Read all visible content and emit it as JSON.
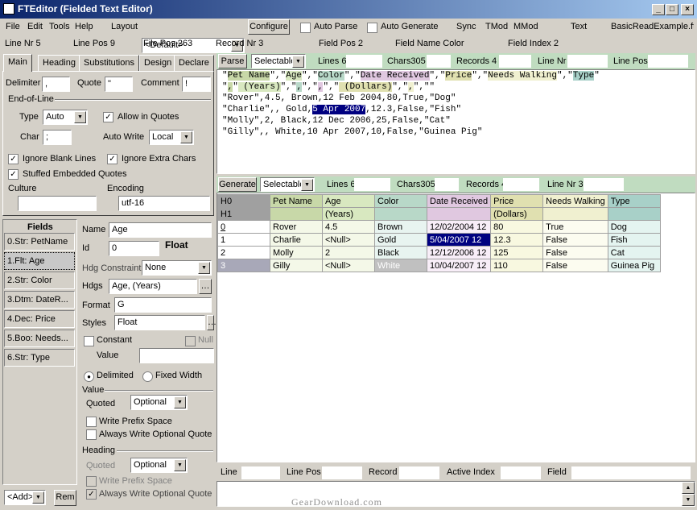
{
  "window": {
    "title": "FTEditor (Fielded Text Editor)",
    "min": "_",
    "max": "□",
    "close": "×"
  },
  "menu": {
    "file": "File",
    "edit": "Edit",
    "tools": "Tools",
    "help": "Help"
  },
  "toolbar": {
    "layout_label": "Layout",
    "layout_value": "<Default>",
    "configure": "Configure",
    "auto_parse": "Auto Parse",
    "auto_generate": "Auto Generate",
    "sync": "Sync",
    "tmod": "TMod",
    "mmod": "MMod",
    "text": "Text",
    "filename": "BasicReadExample.ftx"
  },
  "info": {
    "line_nr": "Line Nr 5",
    "line_pos": "Line Pos 9",
    "file_pos": "File Pos 263",
    "record_nr": "Record Nr 3",
    "field_pos": "Field Pos 2",
    "field_name": "Field Name Color",
    "field_index": "Field Index 2"
  },
  "tabs": [
    "Main",
    "Heading",
    "Substitutions",
    "Design",
    "Declare"
  ],
  "main": {
    "delimiter_label": "Delimiter",
    "delimiter": ",",
    "quote_label": "Quote",
    "quote": "\"",
    "comment_label": "Comment",
    "comment": "!",
    "eol_label": "End-of-Line",
    "type_label": "Type",
    "type": "Auto",
    "char_label": "Char",
    "char": ";",
    "allow_quotes": "Allow in Quotes",
    "auto_write_label": "Auto Write",
    "auto_write": "Local",
    "ignore_blank": "Ignore Blank Lines",
    "ignore_extra": "Ignore Extra Chars",
    "stuffed": "Stuffed Embedded Quotes",
    "culture_label": "Culture",
    "culture": "",
    "encoding_label": "Encoding",
    "encoding": "utf-16"
  },
  "fields": {
    "header": "Fields",
    "items": [
      "0.Str: PetName",
      "1.Flt: Age",
      "2.Str: Color",
      "3.Dtm: DateR...",
      "4.Dec: Price",
      "5.Boo: Needs...",
      "6.Str: Type"
    ],
    "add": "<Add>",
    "rem": "Rem"
  },
  "props": {
    "name_label": "Name",
    "name": "Age",
    "id_label": "Id",
    "id": "0",
    "kind": "Float",
    "hdg_constraint_label": "Hdg Constraint",
    "hdg_constraint": "None",
    "hdgs_label": "Hdgs",
    "hdgs": "Age, (Years)",
    "format_label": "Format",
    "format": "G",
    "styles_label": "Styles",
    "styles": "Float",
    "constant": "Constant",
    "null": "Null",
    "value_label": "Value",
    "delimited": "Delimited",
    "fixed_width": "Fixed Width",
    "value_group": "Value",
    "quoted_label": "Quoted",
    "quoted": "Optional",
    "prefix_space": "Write Prefix Space",
    "always_quote": "Always Write Optional Quote",
    "heading_group": "Heading",
    "h_quoted": "Optional",
    "h_prefix_space": "Write Prefix Space",
    "h_always_quote": "Always Write Optional Quote"
  },
  "textpane": {
    "parse": "Parse",
    "mode": "Selectable",
    "lines": "Lines 6",
    "chars": "Chars305",
    "records": "Records 4",
    "line_nr": "Line Nr",
    "line_pos": "Line Pos"
  },
  "gridpane": {
    "generate": "Generate",
    "mode": "Selectable",
    "lines": "Lines 6",
    "chars": "Chars305",
    "records": "Records 4",
    "line_nr": "Line Nr 3"
  },
  "grid": {
    "h0": [
      "H0",
      "Pet Name",
      "Age",
      "Color",
      "Date Received",
      "Price",
      "Needs Walking",
      "Type"
    ],
    "h1": [
      "H1",
      "",
      "(Years)",
      "",
      "",
      "(Dollars)",
      "",
      ""
    ],
    "rows": [
      [
        "0",
        "Rover",
        "4.5",
        "Brown",
        "12/02/2004 12",
        "80",
        "True",
        "Dog"
      ],
      [
        "1",
        "Charlie",
        "<Null>",
        "Gold",
        "5/04/2007 12",
        "12.3",
        "False",
        "Fish"
      ],
      [
        "2",
        "Molly",
        "2",
        "Black",
        "12/12/2006 12",
        "125",
        "False",
        "Cat"
      ],
      [
        "3",
        "Gilly",
        "<Null>",
        "White",
        "10/04/2007 12",
        "110",
        "False",
        "Guinea Pig"
      ]
    ]
  },
  "statusbar": {
    "line": "Line",
    "line_pos": "Line Pos",
    "record": "Record",
    "active_index": "Active Index",
    "field": "Field"
  },
  "watermark": "GearDownload.com",
  "colors": {
    "c_name": "#c8d8a8",
    "c_age": "#d8e8c0",
    "c_color": "#b8d8c8",
    "c_date": "#e0c8e0",
    "c_price": "#e0e0b0",
    "c_walk": "#f0f0d0",
    "c_type": "#a8d0c8"
  }
}
